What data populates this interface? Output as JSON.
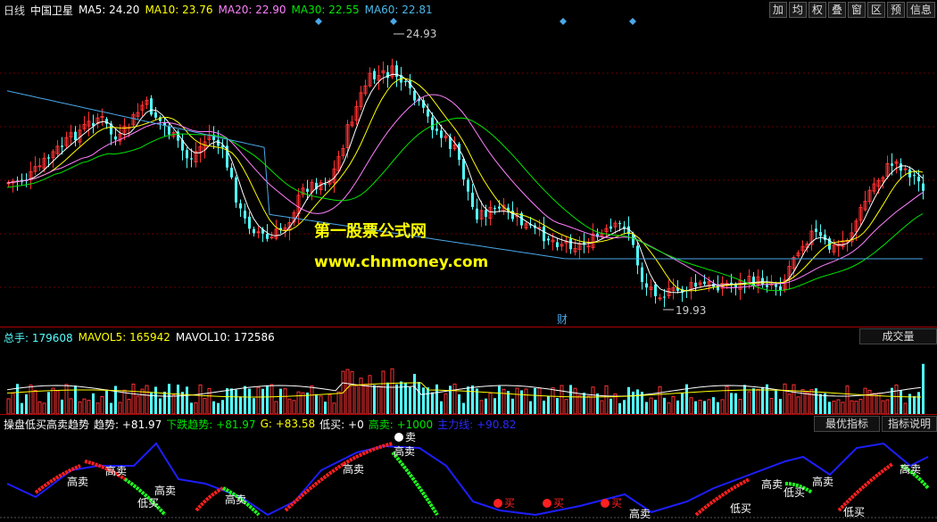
{
  "price_header": {
    "period": "日线",
    "stock": "中国卫星",
    "ma5": "MA5: 24.20",
    "ma10": "MA10: 23.76",
    "ma20": "MA20: 22.90",
    "ma30": "MA30: 22.55",
    "ma60": "MA60: 22.81"
  },
  "toolbar": [
    "加",
    "均",
    "权",
    "叠",
    "窗",
    "区",
    "预",
    "信息"
  ],
  "price_chart": {
    "high_label": "24.93",
    "low_label": "19.93",
    "fin_marker": "财",
    "watermark_line1": "第一股票公式网",
    "watermark_line2": "www.chnmoney.com",
    "colors": {
      "up": "#ff3232",
      "down": "#54ffff",
      "ma5": "#ffffff",
      "ma10": "#ffff00",
      "ma20": "#ff80ff",
      "ma30": "#00e600",
      "ma60": "#4aa8e8"
    }
  },
  "volume_header": {
    "total": "总手: 179608",
    "mavol5": "MAVOL5: 165942",
    "mavol10": "MAVOL10: 172586",
    "tab": "成交量"
  },
  "indicator_header": {
    "name": "操盘低买高卖趋势",
    "trend": "趋势: +81.97",
    "fall": "下跌趋势: +81.97",
    "g": "G: +83.58",
    "low_buy": "低买: +0",
    "high_sell": "高卖: +1000",
    "main": "主力线: +90.82",
    "btn_best": "最优指标",
    "btn_help": "指标说明"
  },
  "indicator_labels": {
    "sell": "卖",
    "buy": "买",
    "high_sell": "高卖",
    "low_buy": "低买"
  }
}
